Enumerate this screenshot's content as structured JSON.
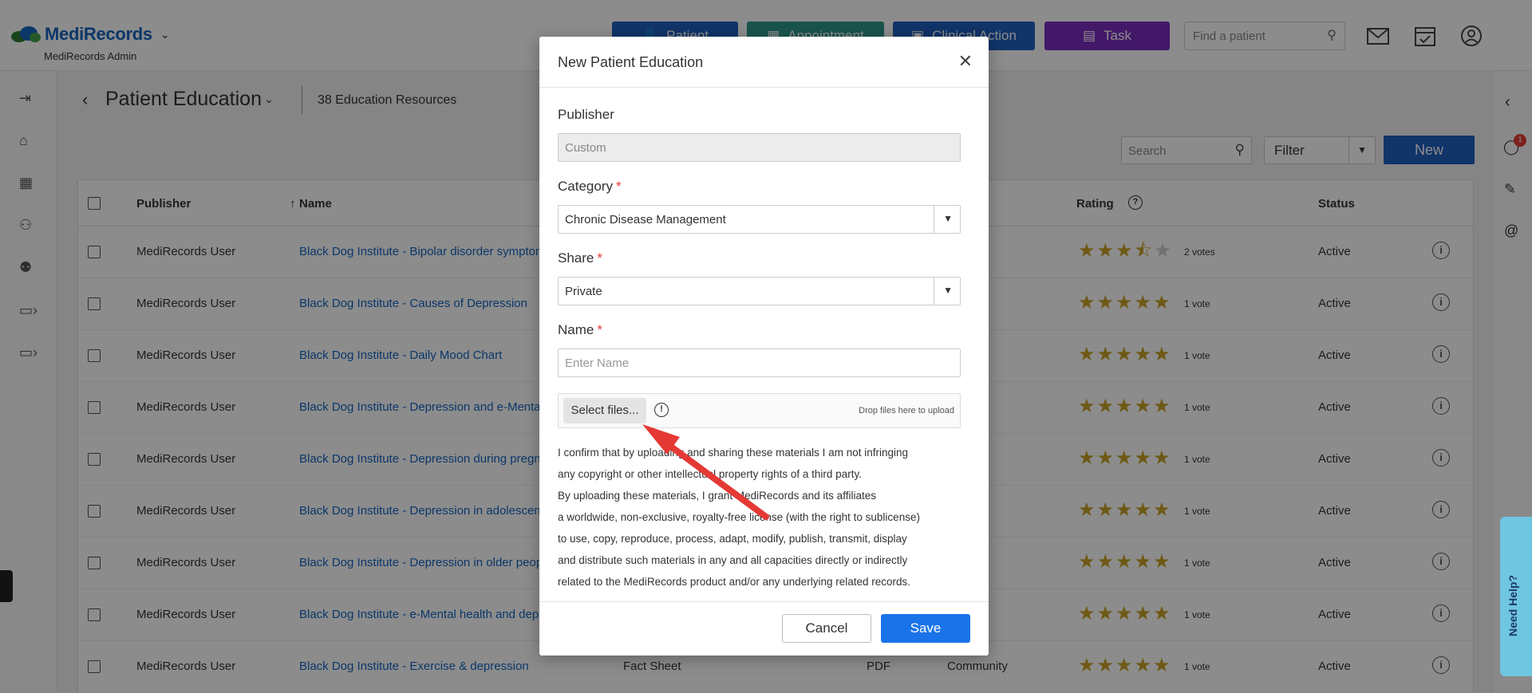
{
  "header": {
    "logo": "MediRecords",
    "subtitle": "MediRecords Admin",
    "buttons": [
      "Patient",
      "Appointment",
      "Clinical Action",
      "Task"
    ],
    "find_placeholder": "Find a patient"
  },
  "page": {
    "title": "Patient Education",
    "count": "38 Education Resources",
    "search_placeholder": "Search",
    "filter_label": "Filter",
    "new_label": "New",
    "notification_count": "1"
  },
  "table": {
    "columns": [
      "Publisher",
      "Name",
      "Rating",
      "Status"
    ],
    "rows": [
      {
        "publisher": "MediRecords User",
        "name": "Black Dog Institute - Bipolar disorder symptom",
        "type": "",
        "format": "",
        "source": "nity",
        "stars": 3.5,
        "votes": "2 votes",
        "status": "Active"
      },
      {
        "publisher": "MediRecords User",
        "name": "Black Dog Institute - Causes of Depression",
        "type": "",
        "format": "",
        "source": "nity",
        "stars": 5,
        "votes": "1 vote",
        "status": "Active"
      },
      {
        "publisher": "MediRecords User",
        "name": "Black Dog Institute - Daily Mood Chart",
        "type": "",
        "format": "",
        "source": "nity",
        "stars": 5,
        "votes": "1 vote",
        "status": "Active"
      },
      {
        "publisher": "MediRecords User",
        "name": "Black Dog Institute - Depression and e-Mental",
        "type": "",
        "format": "",
        "source": "nity",
        "stars": 5,
        "votes": "1 vote",
        "status": "Active"
      },
      {
        "publisher": "MediRecords User",
        "name": "Black Dog Institute - Depression during pregna",
        "type": "",
        "format": "",
        "source": "nity",
        "stars": 5,
        "votes": "1 vote",
        "status": "Active"
      },
      {
        "publisher": "MediRecords User",
        "name": "Black Dog Institute - Depression in adolescents",
        "type": "",
        "format": "",
        "source": "nity",
        "stars": 5,
        "votes": "1 vote",
        "status": "Active"
      },
      {
        "publisher": "MediRecords User",
        "name": "Black Dog Institute - Depression in older peopl",
        "type": "",
        "format": "",
        "source": "nity",
        "stars": 5,
        "votes": "1 vote",
        "status": "Active"
      },
      {
        "publisher": "MediRecords User",
        "name": "Black Dog Institute - e-Mental health and depre",
        "type": "",
        "format": "",
        "source": "nity",
        "stars": 5,
        "votes": "1 vote",
        "status": "Active"
      },
      {
        "publisher": "MediRecords User",
        "name": "Black Dog Institute - Exercise & depression",
        "type": "Fact Sheet",
        "format": "PDF",
        "source": "Community",
        "stars": 5,
        "votes": "1 vote",
        "status": "Active"
      }
    ]
  },
  "modal": {
    "title": "New Patient Education",
    "publisher_label": "Publisher",
    "publisher_value": "Custom",
    "category_label": "Category",
    "category_value": "Chronic Disease Management",
    "share_label": "Share",
    "share_value": "Private",
    "name_label": "Name",
    "name_placeholder": "Enter Name",
    "select_files": "Select files...",
    "drop_hint": "Drop files here to upload",
    "disclaimer": [
      "I confirm that by uploading and sharing these materials I am not infringing",
      "any copyright or other intellectual property rights of a third party.",
      "By uploading these materials, I grant MediRecords and its affiliates",
      "a worldwide, non-exclusive, royalty-free license (with the right to sublicense)",
      "to use, copy, reproduce, process, adapt, modify, publish, transmit, display",
      "and distribute such materials in any and all capacities directly or indirectly",
      "related to the MediRecords product and/or any underlying related records."
    ],
    "cancel": "Cancel",
    "save": "Save"
  },
  "need_help": "Need Help?",
  "colors": {
    "primary": "#1f5fbf",
    "appointment": "#2f9a8a",
    "task": "#7b2cbf",
    "save": "#1a73e8",
    "star": "#c9a227",
    "arrow": "#e53935"
  }
}
